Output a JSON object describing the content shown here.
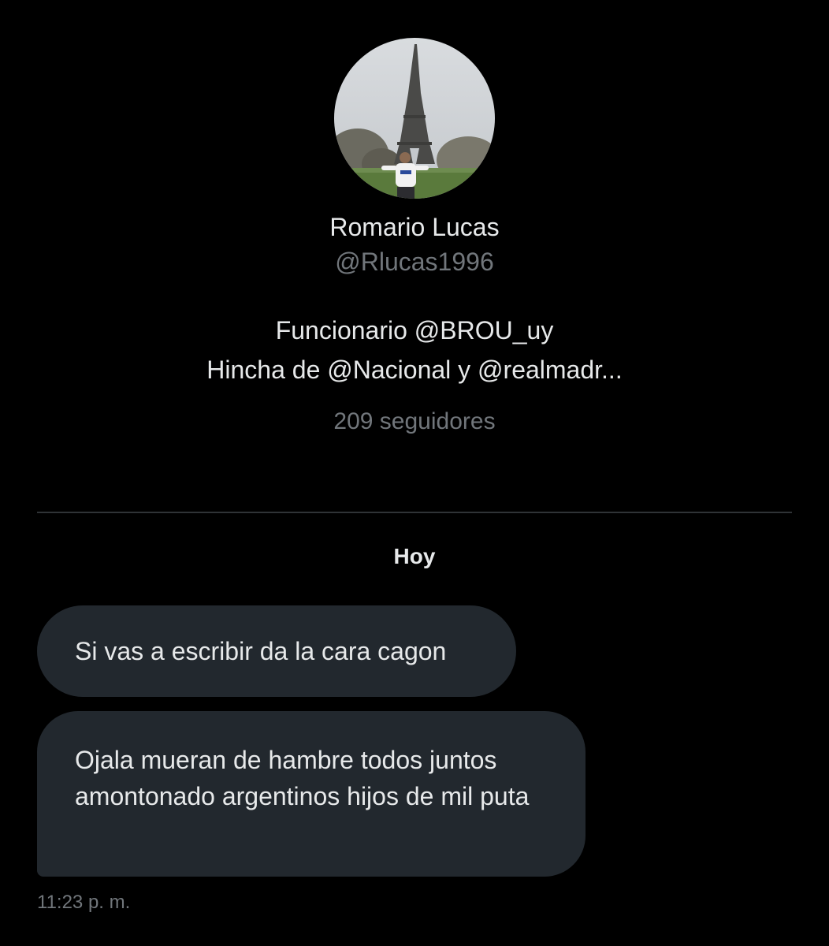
{
  "profile": {
    "name": "Romario Lucas",
    "handle": "@Rlucas1996",
    "bio_line_1": "Funcionario @BROU_uy",
    "bio_line_2": "Hincha de @Nacional y @realmadr...",
    "followers": "209 seguidores",
    "avatar_icon": "profile-photo-eiffel-tower"
  },
  "conversation": {
    "date_separator": "Hoy",
    "messages": [
      {
        "text": "Si vas a escribir da la cara cagon"
      },
      {
        "text": "Ojala mueran de hambre todos juntos amontonado argentinos hijos de mil puta"
      }
    ],
    "timestamp": "11:23 p. m."
  },
  "colors": {
    "background": "#000000",
    "primary_text": "#e7e9ea",
    "secondary_text": "#71767b",
    "bubble_bg": "#22282e",
    "divider": "#2f3336"
  }
}
